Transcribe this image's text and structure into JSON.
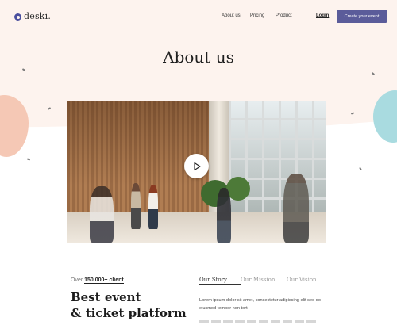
{
  "brand": {
    "name": "deski."
  },
  "nav": {
    "items": [
      "About us",
      "Pricing",
      "Product"
    ],
    "login": "Login",
    "cta": "Create your event"
  },
  "hero": {
    "title": "About us"
  },
  "video": {
    "icon": "play-icon"
  },
  "stats": {
    "prefix": "Over",
    "count": "150.000+ client"
  },
  "headline": {
    "line1": "Best event",
    "line2": "& ticket platform"
  },
  "tabs": [
    "Our Story",
    "Our Mission",
    "Our Vision"
  ],
  "content": {
    "paragraph": "Lorem ipsum dolor sit amet, consectetur adipiscing elit sed do eiusmod tempor non tort"
  },
  "colors": {
    "accent": "#5b5c9a",
    "hero_bg": "#fdf3ee",
    "blob_pink": "#f5c8b5",
    "blob_teal": "#a9dbe0"
  }
}
